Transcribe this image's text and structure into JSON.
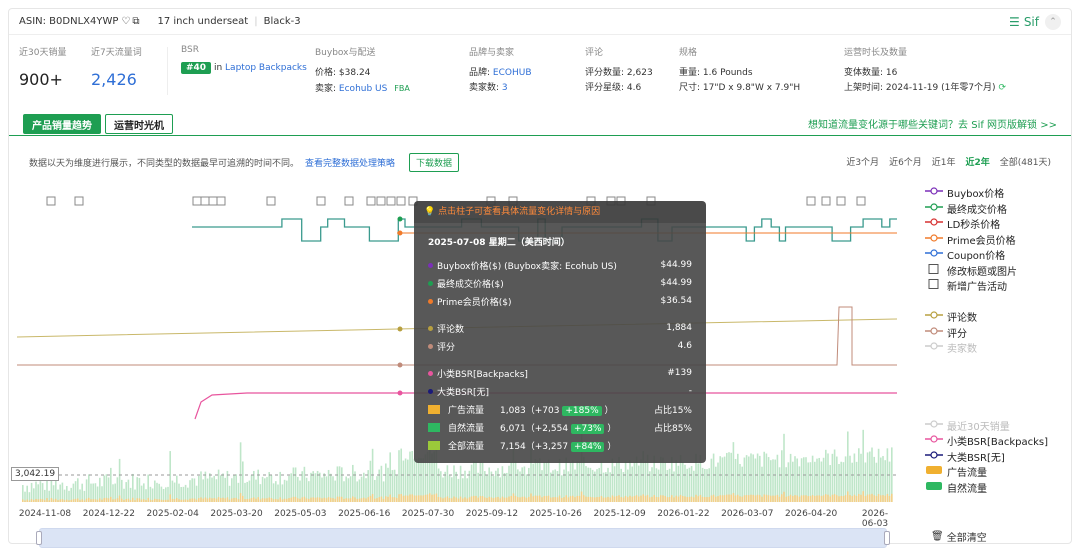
{
  "topbar": {
    "asin": "ASIN: B0DNLX4YWP",
    "title_variant": "17 inch underseat",
    "color_variant": "Black-3",
    "brand": "Sif"
  },
  "stats": {
    "sales30_label": "近30天销量",
    "sales30_value": "900+",
    "traffic7_label": "近7天流量词",
    "traffic7_value": "2,426",
    "bsr_label": "BSR",
    "bsr_rank": "#40",
    "bsr_in": "in",
    "bsr_category": "Laptop Backpacks",
    "buybox_label": "Buybox与配送",
    "price_label": "价格:",
    "price_value": "$38.24",
    "seller_label": "卖家:",
    "seller_value": "Ecohub US",
    "fba": "FBA",
    "brand_label": "品牌与卖家",
    "brand_key": "品牌:",
    "brand_value": "ECOHUB",
    "sellers_key": "卖家数:",
    "sellers_value": "3",
    "review_label": "评论",
    "review_count_key": "评分数量:",
    "review_count_value": "2,623",
    "rating_key": "评分星级:",
    "rating_value": "4.6",
    "spec_label": "规格",
    "weight_key": "重量:",
    "weight_value": "1.6 Pounds",
    "size_key": "尺寸:",
    "size_value": "17\"D x 9.8\"W x 7.9\"H",
    "age_label": "运营时长及数量",
    "variants_key": "变体数量:",
    "variants_value": "16",
    "listed_key": "上架时间:",
    "listed_value": "2024-11-19 (1年零7个月)"
  },
  "tabs": {
    "sales_trend": "产品销量趋势",
    "time_machine": "运营时光机",
    "promo": "想知道流量变化源于哪些关键词？去 Sif 网页版解锁 >>"
  },
  "toolbar": {
    "description": "数据以天为维度进行展示，不同类型的数据最早可追溯的时间不同。",
    "policy_link": "查看完整数据处理策略",
    "download": "下载数据",
    "ranges": [
      "近3个月",
      "近6个月",
      "近1年",
      "近2年",
      "全部(481天)"
    ],
    "active_range": "近2年"
  },
  "chart": {
    "y_marker": "3,042.19",
    "x_ticks": [
      "2024-11-08",
      "2024-12-22",
      "2025-02-04",
      "2025-03-20",
      "2025-05-03",
      "2025-06-16",
      "2025-07-30",
      "2025-09-12",
      "2025-10-26",
      "2025-12-09",
      "2026-01-22",
      "2026-03-07",
      "2026-04-20",
      "2026-06-03"
    ],
    "clear_all": "全部清空"
  },
  "legend": [
    {
      "label": "Buybox价格",
      "color": "#7b2fb8",
      "dim": false,
      "kind": "line"
    },
    {
      "label": "最终成交价格",
      "color": "#1e9e52",
      "dim": false,
      "kind": "line"
    },
    {
      "label": "LD秒杀价格",
      "color": "#d63030",
      "dim": false,
      "kind": "line"
    },
    {
      "label": "Prime会员价格",
      "color": "#f07a2a",
      "dim": false,
      "kind": "line"
    },
    {
      "label": "Coupon价格",
      "color": "#2f6fd6",
      "dim": false,
      "kind": "line"
    },
    {
      "label": "修改标题或图片",
      "color": "#555555",
      "dim": false,
      "kind": "icon"
    },
    {
      "label": "新增广告活动",
      "color": "#555555",
      "dim": false,
      "kind": "icon"
    },
    {
      "label": "",
      "color": "",
      "dim": false,
      "kind": "blank"
    },
    {
      "label": "评论数",
      "color": "#b8a040",
      "dim": false,
      "kind": "line"
    },
    {
      "label": "评分",
      "color": "#c08b7a",
      "dim": false,
      "kind": "line"
    },
    {
      "label": "卖家数",
      "color": "#cccccc",
      "dim": true,
      "kind": "line"
    },
    {
      "label": "",
      "color": "",
      "dim": false,
      "kind": "blank"
    },
    {
      "label": "",
      "color": "",
      "dim": false,
      "kind": "blank"
    },
    {
      "label": "",
      "color": "",
      "dim": false,
      "kind": "blank"
    },
    {
      "label": "",
      "color": "",
      "dim": false,
      "kind": "blank"
    },
    {
      "label": "最近30天销量",
      "color": "#cccccc",
      "dim": true,
      "kind": "line"
    },
    {
      "label": "小类BSR[Backpacks]",
      "color": "#e8559e",
      "dim": false,
      "kind": "line"
    },
    {
      "label": "大类BSR[无]",
      "color": "#1a1a7a",
      "dim": false,
      "kind": "line"
    },
    {
      "label": "广告流量",
      "color": "#f0b030",
      "dim": false,
      "kind": "bar"
    },
    {
      "label": "自然流量",
      "color": "#2eb861",
      "dim": false,
      "kind": "bar"
    }
  ],
  "tooltip": {
    "header": "点击柱子可查看具体流量变化详情与原因",
    "date": "2025-07-08  星期二（美西时间）",
    "rows": [
      {
        "dot": "#7b2fb8",
        "name": "Buybox价格($) (Buybox卖家: Ecohub US)",
        "value": "$44.99"
      },
      {
        "dot": "#1e9e52",
        "name": "最终成交价格($)",
        "value": "$44.99"
      },
      {
        "dot": "#f07a2a",
        "name": "Prime会员价格($)",
        "value": "$36.54"
      }
    ],
    "rows2": [
      {
        "dot": "#b8a040",
        "name": "评论数",
        "value": "1,884"
      },
      {
        "dot": "#c08b7a",
        "name": "评分",
        "value": "4.6"
      }
    ],
    "rows3": [
      {
        "dot": "#e8559e",
        "name": "小类BSR[Backpacks]",
        "value": "#139"
      },
      {
        "dot": "#1a1a7a",
        "name": "大类BSR[无]",
        "value": "-"
      }
    ],
    "traffic": [
      {
        "color": "#f0b030",
        "name": "广告流量",
        "value": "1,083（+703",
        "pct": "+185%",
        "close": "）",
        "share": "占比15%"
      },
      {
        "color": "#2eb861",
        "name": "自然流量",
        "value": "6,071（+2,554",
        "pct": "+73%",
        "close": "）",
        "share": "占比85%"
      },
      {
        "color": "#9bc93a",
        "name": "全部流量",
        "value": "7,154（+3,257",
        "pct": "+84%",
        "close": "）",
        "share": ""
      }
    ]
  }
}
